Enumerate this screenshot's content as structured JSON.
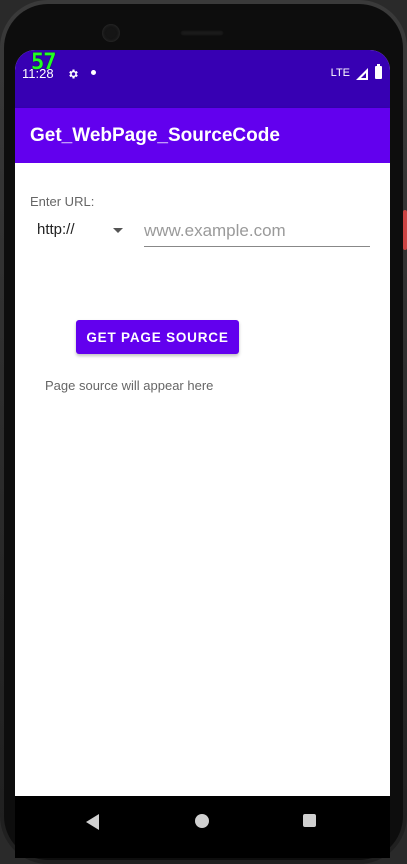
{
  "status_bar": {
    "time": "11:28",
    "fps_counter": "57",
    "network": "LTE",
    "icons": {
      "settings": "gear-icon",
      "notification": "dot-icon",
      "signal": "signal-icon",
      "battery": "battery-icon"
    }
  },
  "app_bar": {
    "title": "Get_WebPage_SourceCode"
  },
  "form": {
    "label": "Enter URL:",
    "protocol": {
      "selected": "http://"
    },
    "url_input": {
      "value": "",
      "placeholder": "www.example.com"
    },
    "button_label": "GET PAGE SOURCE",
    "output_text": "Page source will appear here"
  },
  "nav_bar": {
    "back": "back-icon",
    "home": "home-icon",
    "recents": "recents-icon"
  },
  "colors": {
    "status_bar": "#3700b3",
    "app_bar": "#6200ee",
    "button": "#6200ee"
  }
}
